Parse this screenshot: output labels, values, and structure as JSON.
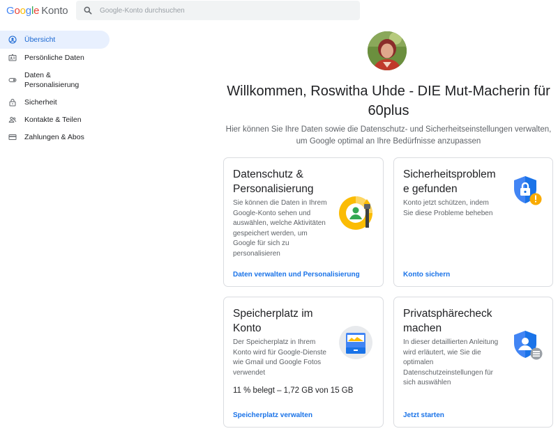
{
  "header": {
    "logo_google": "Google",
    "logo_konto": "Konto",
    "search_placeholder": "Google-Konto durchsuchen"
  },
  "sidebar": {
    "items": [
      {
        "label": "Übersicht",
        "icon": "account-circle-icon",
        "active": true
      },
      {
        "label": "Persönliche Daten",
        "icon": "id-card-icon"
      },
      {
        "label": "Daten & Personalisierung",
        "icon": "toggle-icon"
      },
      {
        "label": "Sicherheit",
        "icon": "lock-icon"
      },
      {
        "label": "Kontakte & Teilen",
        "icon": "people-icon"
      },
      {
        "label": "Zahlungen & Abos",
        "icon": "credit-card-icon"
      }
    ]
  },
  "main": {
    "welcome": "Willkommen, Roswitha Uhde - DIE Mut-Macherin für 60plus",
    "subtitle": "Hier können Sie Ihre Daten sowie die Datenschutz- und Sicherheitseinstellungen verwalten, um Google optimal an Ihre Bedürfnisse anzupassen",
    "cards": [
      {
        "title": "Datenschutz & Personalisierung",
        "desc": "Sie können die Daten in Ihrem Google-Konto sehen und auswählen, welche Aktivitäten gespeichert werden, um Google für sich zu personalisieren",
        "link": "Daten verwalten und Personalisierung"
      },
      {
        "title": "Sicherheitsproblem e gefunden",
        "desc": "Konto jetzt schützen, indem Sie diese Probleme beheben",
        "link": "Konto sichern"
      },
      {
        "title": "Speicherplatz im Konto",
        "desc": "Der Speicherplatz in Ihrem Konto wird für Google-Dienste wie Gmail und Google Fotos verwendet",
        "stat": "11 % belegt – 1,72 GB von 15 GB",
        "link": "Speicherplatz verwalten"
      },
      {
        "title": "Privatsphärecheck machen",
        "desc": "In dieser detaillierten Anleitung wird erläutert, wie Sie die optimalen Datenschutzeinstellungen für sich auswählen",
        "link": "Jetzt starten"
      }
    ]
  },
  "colors": {
    "google_blue": "#4285f4",
    "google_red": "#ea4335",
    "google_yellow": "#fbbc04",
    "google_green": "#34a853",
    "link": "#1a73e8",
    "active_nav_bg": "#e8f0fe"
  }
}
